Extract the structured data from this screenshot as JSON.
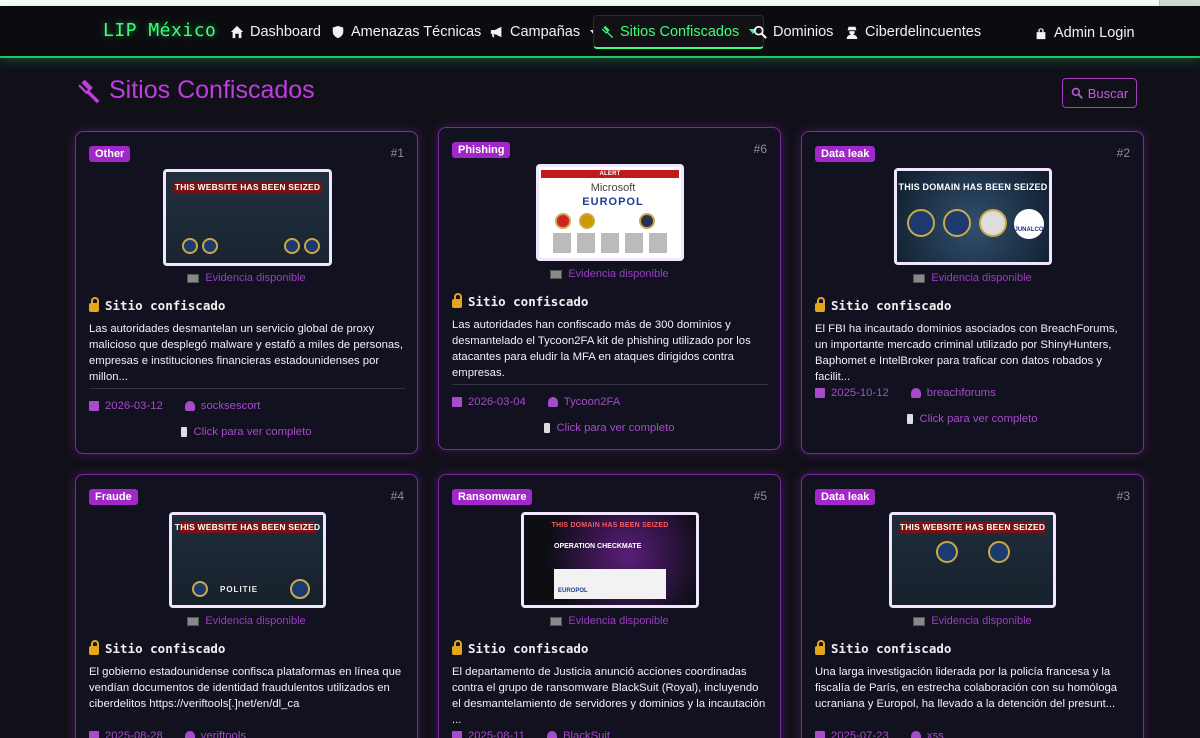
{
  "nav": {
    "brand": "LIP México",
    "items": [
      {
        "label": "Dashboard",
        "icon": "home-icon"
      },
      {
        "label": "Amenazas Técnicas",
        "icon": "shield-icon"
      },
      {
        "label": "Campañas",
        "icon": "megaphone-icon"
      },
      {
        "label": "Sitios Confiscados",
        "icon": "gavel-icon"
      },
      {
        "label": "Dominios",
        "icon": "search-icon"
      },
      {
        "label": "Ciberdelincuentes",
        "icon": "user-secret-icon"
      }
    ],
    "admin": "Admin Login"
  },
  "page": {
    "title": "Sitios Confiscados",
    "search_label": "Buscar"
  },
  "colors": {
    "accent_green": "#39ff7a",
    "accent_purple": "#c13ce0",
    "badge": "#a227c9"
  },
  "common": {
    "evidence": "Evidencia disponible",
    "status": "Sitio confiscado",
    "view_more": "Click para ver completo"
  },
  "cards": [
    {
      "badge": "Other",
      "num": "#1",
      "seized_text": "THIS WEBSITE HAS BEEN SEIZED",
      "desc": "Las autoridades desmantelan un servicio global de proxy malicioso que desplegó malware y estafó a miles de personas, empresas e instituciones financieras estadounidenses por millon...",
      "date": "2026-03-12",
      "actor": "socksescort"
    },
    {
      "badge": "Phishing",
      "num": "#6",
      "seized_text": "ALERT",
      "desc": "Las autoridades han confiscado más de 300 dominios y desmantelado el Tycoon2FA kit de phishing utilizado por los atacantes para eludir la MFA en ataques dirigidos contra empresas.",
      "date": "2026-03-04",
      "actor": "Tycoon2FA",
      "logo1": "Microsoft",
      "logo2": "EUROPOL"
    },
    {
      "badge": "Data leak",
      "num": "#2",
      "seized_text": "THIS DOMAIN HAS BEEN SEIZED",
      "desc": "El FBI ha incautado dominios asociados con BreachForums, un importante mercado criminal utilizado por ShinyHunters, Baphomet e IntelBroker para traficar con datos robados y facilit...",
      "date": "2025-10-12",
      "actor": "breachforums",
      "logo1": "JUNALCO"
    },
    {
      "badge": "Fraude",
      "num": "#4",
      "seized_text": "THIS WEBSITE HAS BEEN SEIZED",
      "desc": "El gobierno estadounidense confisca plataformas en línea que vendían documentos de identidad fraudulentos utilizados en ciberdelitos https://veriftools[.]net/en/dl_ca",
      "date": "2025-08-28",
      "actor": "veriftools",
      "logo1": "POLITIE"
    },
    {
      "badge": "Ransomware",
      "num": "#5",
      "seized_text": "THIS DOMAIN HAS BEEN SEIZED",
      "desc": "El departamento de Justicia anunció acciones coordinadas contra el grupo de ransomware BlackSuit (Royal), incluyendo el desmantelamiento de servidores y dominios y la incautación ...",
      "date": "2025-08-11",
      "actor": "BlackSuit",
      "logo1": "OPERATION CHECKMATE",
      "logo2": "EUROPOL"
    },
    {
      "badge": "Data leak",
      "num": "#3",
      "seized_text": "THIS WEBSITE HAS BEEN SEIZED",
      "desc": "Una larga investigación liderada por la policía francesa y la fiscalía de París, en estrecha colaboración con su homóloga ucraniana y Europol, ha llevado a la detención del presunt...",
      "date": "2025-07-23",
      "actor": "xss"
    }
  ]
}
